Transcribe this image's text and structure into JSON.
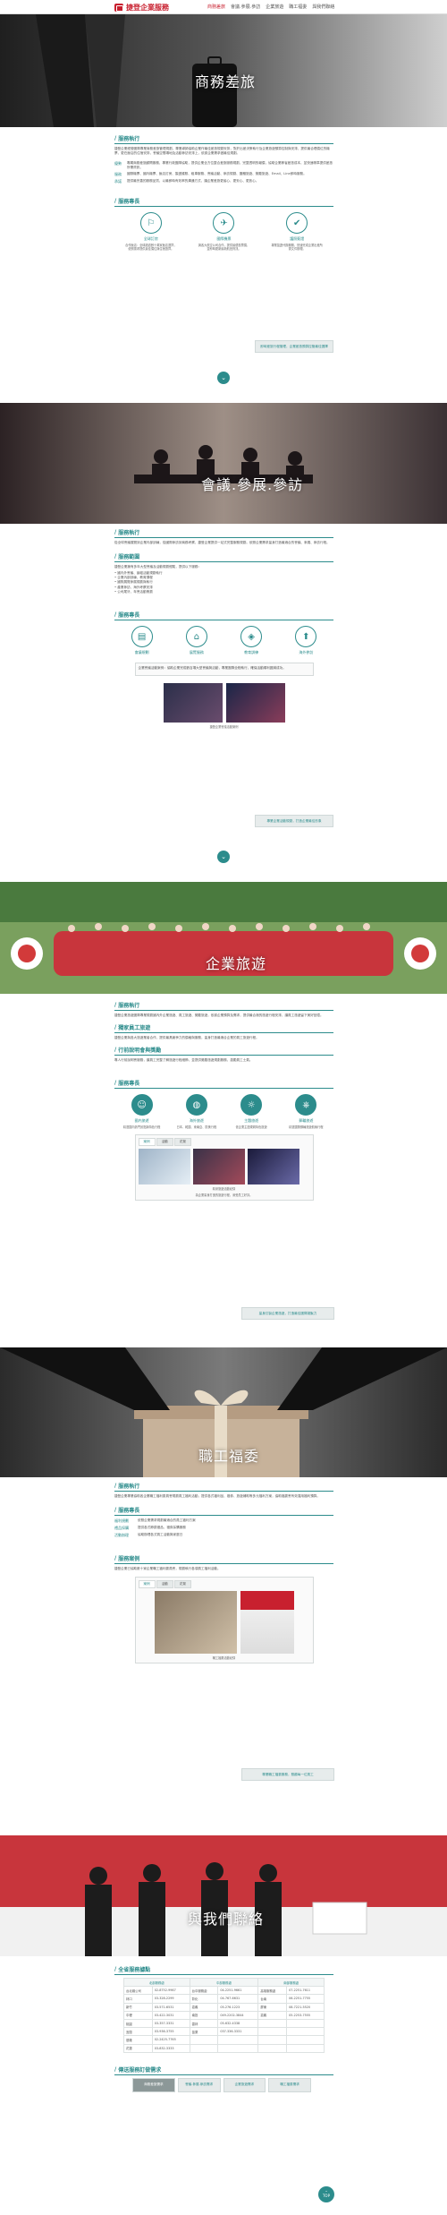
{
  "brand": {
    "name": "捷登企業服務"
  },
  "nav": [
    "商務差旅",
    "會議.參展.參訪",
    "企業旅遊",
    "職工福委",
    "與我們聯絡"
  ],
  "hero1": {
    "title": "商務差旅"
  },
  "sec1": {
    "intro_head": "服務執行",
    "intro_text": "捷登企業經營團隊專業商務差旅管理規劃，專業導師協助企業作最佳差旅規劃安排，對於出差決策執行及企業旅遊預算控制與安排，提供最合理價位的機票，更在飯店的住宿安排，會議空間場地及活動參訪安排上，依據企業需求做最佳規劃。",
    "rows": [
      {
        "k": "優勢",
        "v": "專屬商務差旅顧問服務，專業行政團隊協助，提供企業全方位整合差旅服務規劃，完整透明的報價，協助企業節省差旅成本，並快速精準提供差旅所需資訊。"
      },
      {
        "k": "服務",
        "v": "國際機票、國內機票、飯店訂房、簽證護照、租車服務、會議活動、參訪規劃、團體旅遊、獎勵旅遊、Email、Line即時服務。"
      },
      {
        "k": "承諾",
        "v": "提供最完善的服務品質，以最即時有效率的溝通方式，讓企業差旅更省心、更安心、更放心。"
      }
    ],
    "service_head": "服務專長",
    "icons": [
      {
        "icon": "⚐",
        "label": "全球訂房",
        "desc": "合作飯店：全球超過數十萬家飯店選擇，依照需求提供最佳價位與住宿選擇。"
      },
      {
        "icon": "✈",
        "label": "國際機票",
        "desc": "與各大航空公司合作，提供最優惠票價，並即時更新最新航班資訊。"
      },
      {
        "icon": "✔",
        "label": "護照簽證",
        "desc": "專業簽證代辦服務，快速完成企業出差所需文件辦理。"
      }
    ],
    "ribbon": "即時差旅行程管理，企業差旅預算控管最佳選擇"
  },
  "hero2": {
    "title": "會議.參展.參訪"
  },
  "sec2": {
    "intro_head": "服務執行",
    "intro_text": "從全球會議展覽到企業內部訓練，從國際參訪到商務考察，捷登企業提供一站式完整服務規劃。依照企業需求量身打造最適合的會議、參展、參訪行程。",
    "scope_head": "服務範圍",
    "scope_intro": "捷登企業擁有多年大型會議及活動規劃經驗，提供以下服務：",
    "bullets": [
      "國內外會議、論壇活動規劃執行",
      "企業內部訓練、教育課程",
      "國際展覽參展規劃與執行",
      "產業參訪、海外考察安排",
      "公司尾牙、年會活動策劃"
    ],
    "service_head": "服務專長",
    "icons": [
      {
        "icon": "▤",
        "label": "會議規劃"
      },
      {
        "icon": "⌂",
        "label": "展覽服務"
      },
      {
        "icon": "◈",
        "label": "教育訓練"
      },
      {
        "icon": "⬆",
        "label": "海外參訪"
      }
    ],
    "case_text": "企業會議活動案例：協助企業完成數百場大型會議與活動，專業團隊全程執行，確保活動順利圓滿成功。",
    "photo_caption": "捷登企業會議活動案例",
    "ribbon": "專業企業活動規劃，打造企業最佳形象"
  },
  "hero3": {
    "title": "企業旅遊"
  },
  "sec3": {
    "head1": "服務執行",
    "text1": "捷登企業旅遊團隊專業規劃國內外企業旅遊、員工旅遊、獎勵旅遊，依據企業預算及需求，提供最合適的旅遊行程安排，讓員工旅遊留下美好回憶。",
    "head2": "獨家員工旅遊",
    "text2": "捷登企業與各大旅遊業者合作，提供最具競爭力的價格與服務，量身打造最適合企業的員工旅遊行程。",
    "head3": "行前說明會與獎勵",
    "text3": "專人行前說明會服務，讓員工完整了解旅遊行程細節，並提供獎勵旅遊規劃服務，激勵員工士氣。",
    "service_head": "服務專長",
    "icons": [
      {
        "icon": "☺",
        "label": "國內旅遊",
        "desc": "精選國內熱門景點與特色行程"
      },
      {
        "icon": "◍",
        "label": "海外旅遊",
        "desc": "日本、韓國、東南亞、歐美行程"
      },
      {
        "icon": "☼",
        "label": "主題旅遊",
        "desc": "依企業主題規劃特色旅遊"
      },
      {
        "icon": "⎈",
        "label": "郵輪旅遊",
        "desc": "精選國際郵輪旅遊航線行程"
      }
    ],
    "tabs": [
      "案例",
      "活動",
      "花絮"
    ],
    "photo_caption": "精采旅遊活動紀錄",
    "case_desc": "為企業量身打造的旅遊行程，深受員工好評。",
    "ribbon": "量身訂製企業旅遊，打造最佳團隊凝聚力"
  },
  "hero4": {
    "title": "職工福委"
  },
  "sec4": {
    "head1": "服務執行",
    "text1": "捷登企業專業協助各企業職工福利委員會規劃員工福利活動，提供各式福利品、禮券、旅遊補助等多元福利方案，協助福委會有效運用福利預算。",
    "head2": "服務專長",
    "rows": [
      {
        "k": "福利規劃",
        "v": "依照企業需求規劃最適合的員工福利方案"
      },
      {
        "k": "禮品採購",
        "v": "提供各式節慶禮品、禮券採購服務"
      },
      {
        "k": "活動辦理",
        "v": "協助辦理各式員工活動與家庭日"
      }
    ],
    "head3": "服務案例",
    "text3": "捷登企業已協助數十家企業職工福利委員會，規劃執行各項員工福利活動。",
    "tabs": [
      "案例",
      "活動",
      "花絮"
    ],
    "photo_caption": "職工福委活動紀錄",
    "ribbon": "專業職工福委服務，照顧每一位員工"
  },
  "hero5": {
    "title": "與我們聯絡"
  },
  "contact": {
    "head": "全省服務據點",
    "cols": [
      "北部服務處",
      "中部服務處",
      "南部服務處"
    ],
    "rows": [
      [
        "台北總公司",
        "02-8752-9967",
        "台中服務處",
        "04-2251-9661",
        "高雄服務處",
        "07-2251-7611"
      ],
      [
        "林口",
        "03-328-2299",
        "彰化",
        "04-767-6631",
        "台南",
        "06-2251-7755"
      ],
      [
        "新竹",
        "03-571-6531",
        "嘉義",
        "05-276-1223",
        "屏東",
        "08-7221-5520"
      ],
      [
        "中壢",
        "03-422-3031",
        "南投",
        "049-2202-3844",
        "嘉義",
        "05-2253-7555"
      ],
      [
        "桃園",
        "03-357-3331",
        "雲林",
        "05-632-4338",
        "",
        ""
      ],
      [
        "宜蘭",
        "03-936-3755",
        "苗栗",
        "037-336-3331",
        "",
        ""
      ],
      [
        "基隆",
        "02-2425-7765",
        "",
        "",
        "",
        ""
      ],
      [
        "花蓮",
        "03-832-3333",
        "",
        "",
        "",
        ""
      ]
    ],
    "links_head": "傳送服務訂做需求",
    "links": [
      "商務差旅需求",
      "會議.參展.參訪需求",
      "企業旅遊需求",
      "職工福委需求"
    ],
    "top": "TOP"
  }
}
